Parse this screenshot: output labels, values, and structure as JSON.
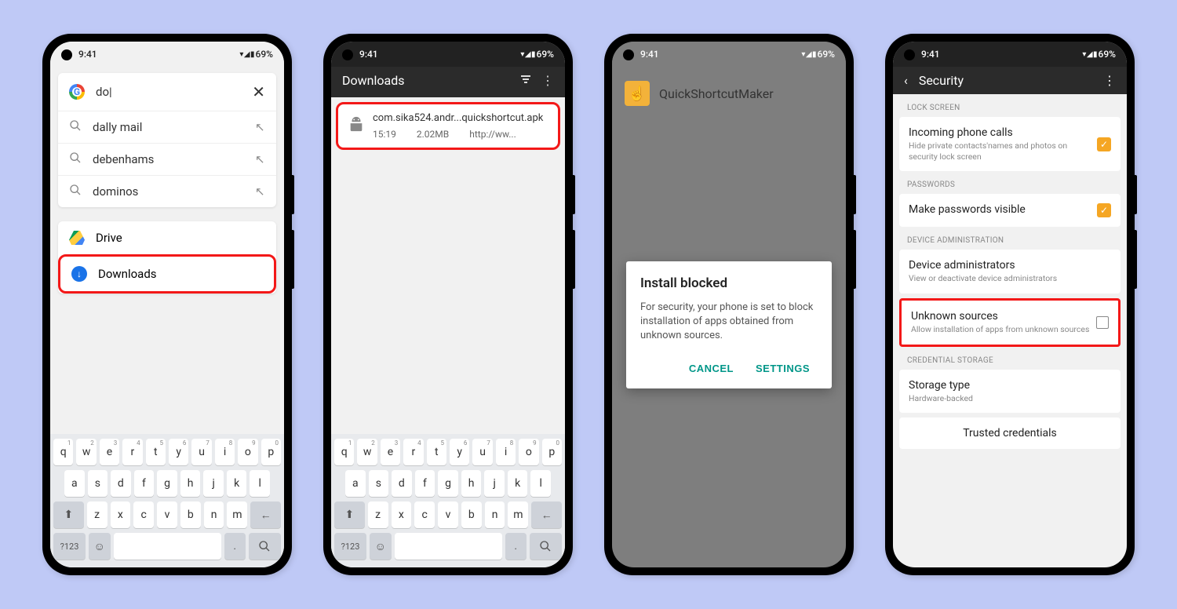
{
  "status": {
    "time": "9:41",
    "battery": "69%"
  },
  "phone1": {
    "query": "do|",
    "suggestions": [
      "dally mail",
      "debenhams",
      "dominos"
    ],
    "options": {
      "drive": "Drive",
      "downloads": "Downloads"
    }
  },
  "phone2": {
    "title": "Downloads",
    "file": {
      "name": "com.sika524.andr...quickshortcut.apk",
      "time": "15:19",
      "size": "2.02MB",
      "src": "http://ww..."
    }
  },
  "phone3": {
    "app": "QuickShortcutMaker",
    "dialog": {
      "title": "Install blocked",
      "body": "For security, your phone is set to block installation of apps obtained from unknown sources.",
      "cancel": "CANCEL",
      "settings": "SETTINGS"
    }
  },
  "phone4": {
    "title": "Security",
    "sections": {
      "lock": "LOCK SCREEN",
      "pass": "PASSWORDS",
      "admin": "DEVICE ADMINISTRATION",
      "cred": "CREDENTIAL STORAGE"
    },
    "items": {
      "incoming": {
        "t": "Incoming phone calls",
        "d": "Hide private contacts'names and photos on security lock screen"
      },
      "makepw": {
        "t": "Make passwords visible"
      },
      "devadmin": {
        "t": "Device administrators",
        "d": "View or deactivate device administrators"
      },
      "unknown": {
        "t": "Unknown sources",
        "d": "Allow installation of apps from unknown sources"
      },
      "storage": {
        "t": "Storage type",
        "d": "Hardware-backed"
      },
      "trusted": {
        "t": "Trusted credentials"
      }
    }
  },
  "keyboard": {
    "r1": [
      "q",
      "w",
      "e",
      "r",
      "t",
      "y",
      "u",
      "i",
      "o",
      "p"
    ],
    "r2": [
      "a",
      "s",
      "d",
      "f",
      "g",
      "h",
      "j",
      "k",
      "l"
    ],
    "r3": [
      "z",
      "x",
      "c",
      "v",
      "b",
      "n",
      "m"
    ],
    "nums": [
      "1",
      "2",
      "3",
      "4",
      "5",
      "6",
      "7",
      "8",
      "9",
      "0"
    ],
    "sym": "?123"
  }
}
